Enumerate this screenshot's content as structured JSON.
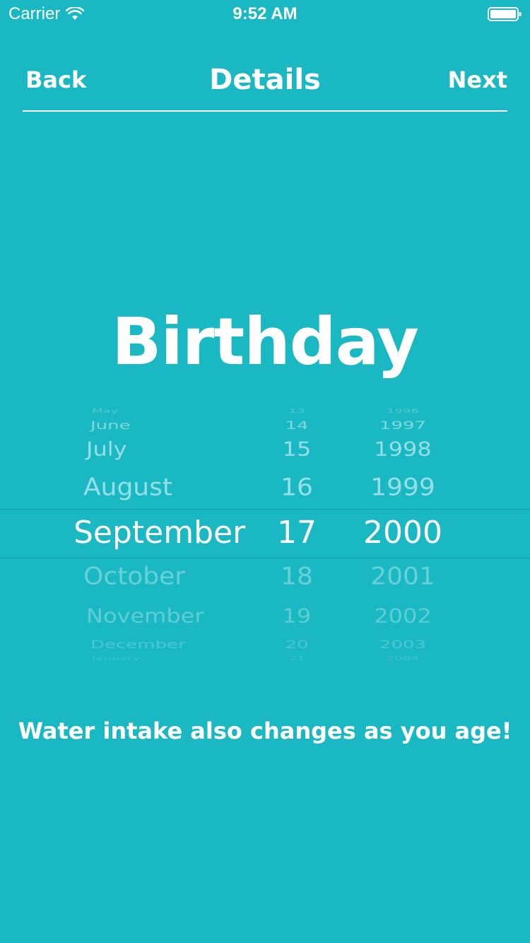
{
  "status_bar": {
    "carrier": "Carrier",
    "time": "9:52 AM",
    "wifi_icon": "wifi-icon",
    "battery_icon": "battery-icon"
  },
  "nav": {
    "back_label": "Back",
    "title": "Details",
    "next_label": "Next"
  },
  "heading": "Birthday",
  "picker": {
    "selected": {
      "month": "September",
      "day": "17",
      "year": "2000"
    },
    "months": [
      "May",
      "June",
      "July",
      "August",
      "September",
      "October",
      "November",
      "December",
      "January"
    ],
    "days": [
      "13",
      "14",
      "15",
      "16",
      "17",
      "18",
      "19",
      "20",
      "21"
    ],
    "years": [
      "1996",
      "1997",
      "1998",
      "1999",
      "2000",
      "2001",
      "2002",
      "2003",
      "2004"
    ]
  },
  "helper_text": "Water intake also changes as you age!",
  "colors": {
    "background": "#19b8c3",
    "text": "#ffffff",
    "picker_text_dim": "#8fdbe1"
  }
}
